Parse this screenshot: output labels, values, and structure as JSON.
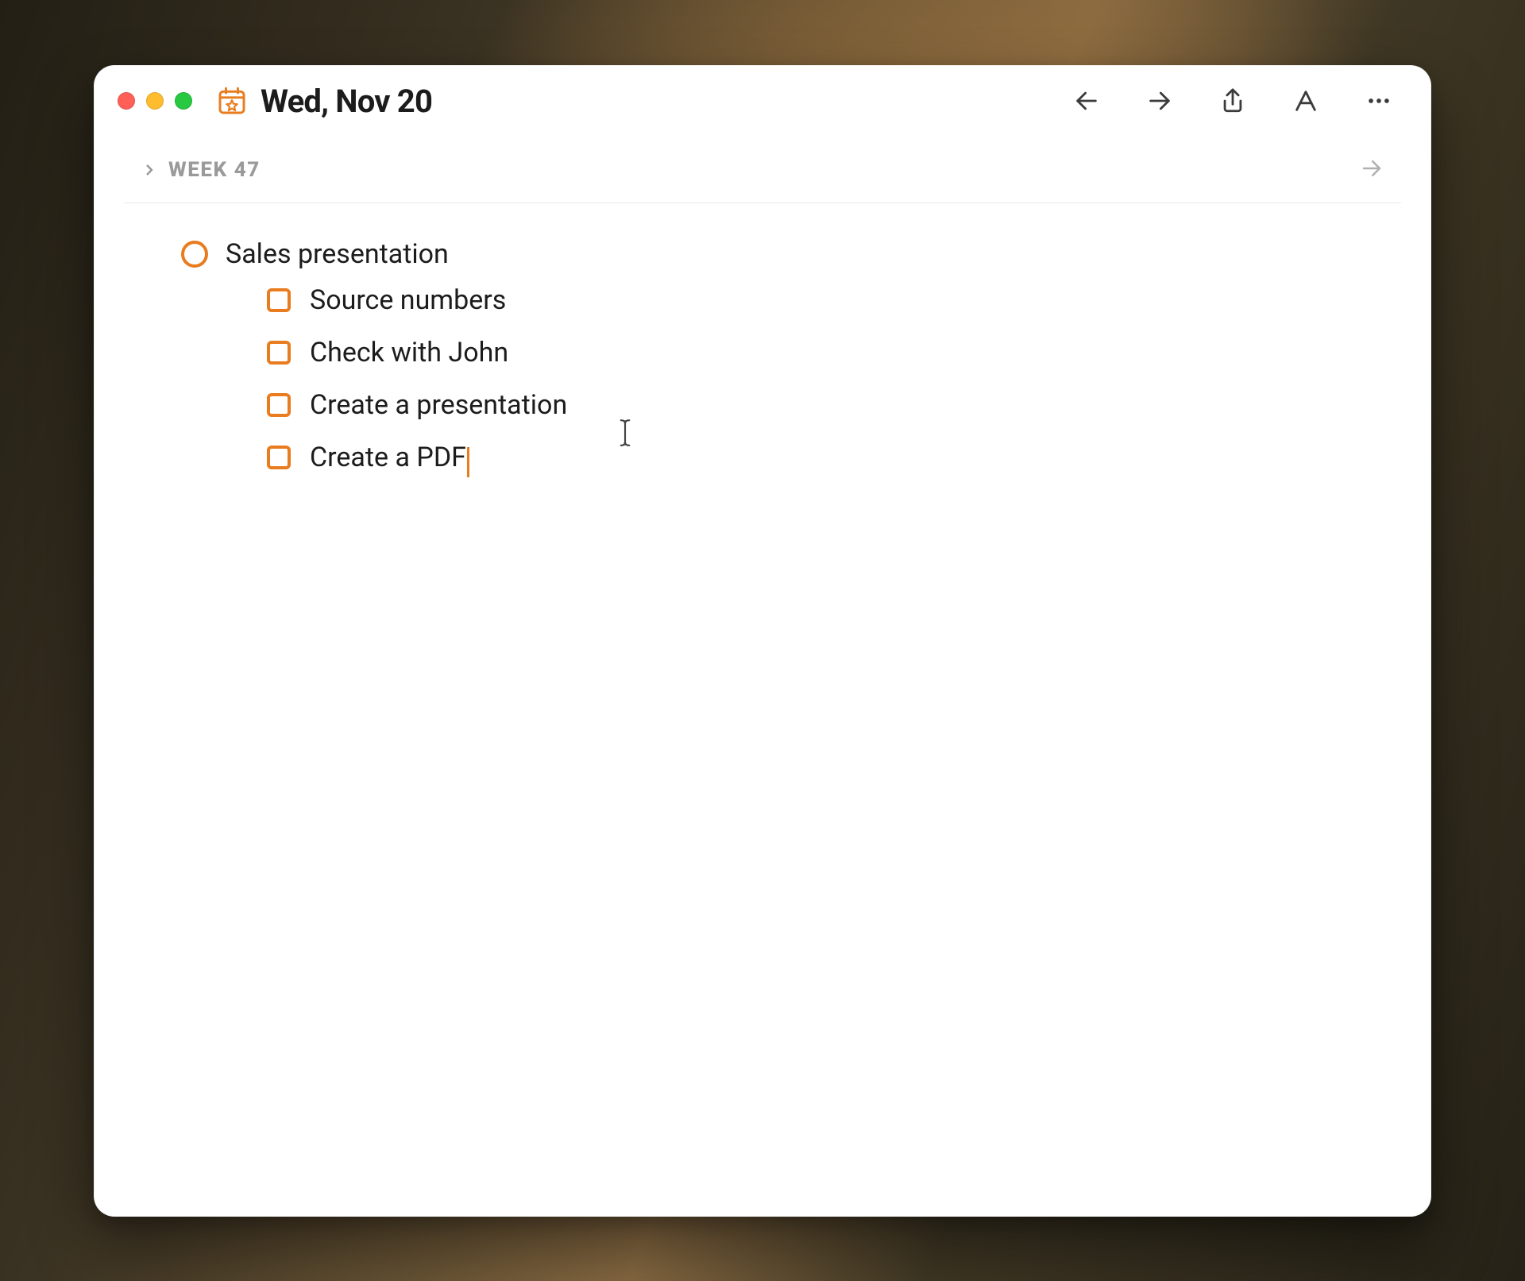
{
  "colors": {
    "accent": "#e87c1e",
    "traffic_red": "#ff5f57",
    "traffic_yellow": "#febc2e",
    "traffic_green": "#28c840"
  },
  "titlebar": {
    "date_label": "Wed, Nov 20",
    "icon": "calendar-star-icon"
  },
  "toolbar": {
    "back_icon": "arrow-left-icon",
    "forward_icon": "arrow-right-icon",
    "share_icon": "share-icon",
    "font_icon": "font-icon",
    "more_icon": "more-icon"
  },
  "week": {
    "label": "WEEK 47",
    "expand_icon": "chevron-right-icon",
    "next_icon": "arrow-right-icon"
  },
  "tasks": [
    {
      "type": "task",
      "text": "Sales presentation",
      "checked": false,
      "subtasks": [
        {
          "text": "Source numbers",
          "checked": false
        },
        {
          "text": "Check with John",
          "checked": false
        },
        {
          "text": "Create a presentation",
          "checked": false
        },
        {
          "text": "Create a PDF",
          "checked": false,
          "cursor": true
        }
      ]
    }
  ]
}
